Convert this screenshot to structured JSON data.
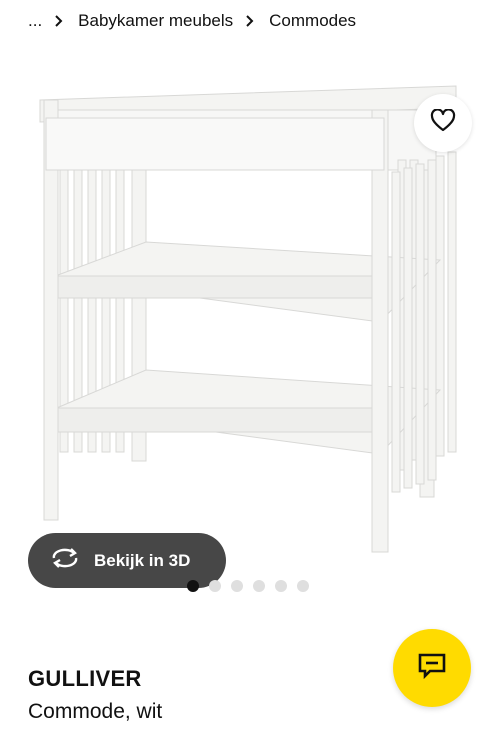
{
  "breadcrumb": {
    "items": [
      {
        "label": "..."
      },
      {
        "label": "Babykamer meubels"
      },
      {
        "label": "Commodes"
      }
    ]
  },
  "media": {
    "view_3d_label": "Bekijk in 3D",
    "dots_total": 6,
    "active_dot": 1
  },
  "product": {
    "name": "GULLIVER",
    "description": "Commode, wit"
  },
  "icons": {
    "favorite": "heart-icon",
    "view_3d": "rotate-3d-icon",
    "chat": "chat-icon",
    "separator": "chevron-right-icon"
  },
  "colors": {
    "chat_button": "#ffdb00",
    "view_3d_button": "#474747",
    "dot_active": "#111111",
    "dot_inactive": "#dfdfdf"
  }
}
